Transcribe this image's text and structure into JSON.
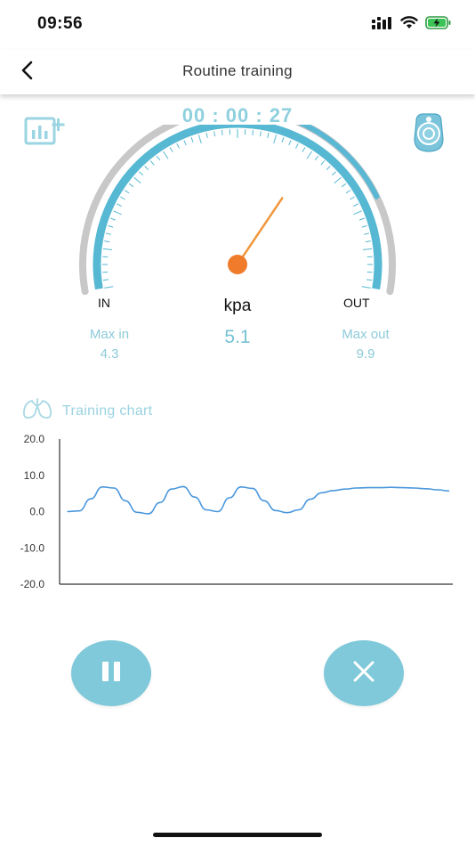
{
  "status": {
    "time": "09:56",
    "icons": [
      "signal-icon",
      "wifi-icon",
      "battery-charging-icon"
    ]
  },
  "header": {
    "title": "Routine training",
    "back_icon": "chevron-left-icon"
  },
  "session": {
    "timer": "00 : 00 : 27",
    "left_icon": "chart-add-icon",
    "right_icon": "device-icon"
  },
  "gauge": {
    "in_label": "IN",
    "out_label": "OUT",
    "unit": "kpa",
    "needle_fraction": 0.67,
    "progress_fraction_start": 0.54,
    "progress_fraction_end": 0.82,
    "colors": {
      "track": "#c8c8c8",
      "scale": "#56b8d2",
      "progress": "#5ab8d4",
      "needle": "#f0973c",
      "pivot": "#ef7b2b"
    }
  },
  "stats": {
    "max_in_label": "Max in",
    "max_in_value": "4.3",
    "current_value": "5.1",
    "max_out_label": "Max out",
    "max_out_value": "9.9"
  },
  "training": {
    "title": "Training chart",
    "icon": "lungs-icon"
  },
  "chart_data": {
    "type": "line",
    "ylim": [
      -20,
      20
    ],
    "yticks": [
      "20.0",
      "10.0",
      "0.0",
      "-10.0",
      "-20.0"
    ],
    "ytick_values": [
      20,
      10,
      0,
      -10,
      -20
    ],
    "x": [
      0,
      3,
      6,
      9,
      12,
      15,
      18,
      21,
      24,
      27,
      30,
      33,
      36,
      39,
      42,
      45,
      48,
      51,
      54,
      57,
      60,
      63,
      66,
      69,
      72,
      75,
      78,
      81,
      84,
      87,
      90,
      93,
      96,
      99
    ],
    "series": [
      {
        "values": [
          0,
          0.2,
          3.5,
          6.8,
          6.5,
          3.0,
          -0.2,
          -0.6,
          2.5,
          6.2,
          6.9,
          4.0,
          0.5,
          0,
          3.8,
          6.8,
          6.4,
          3.0,
          0.3,
          -0.3,
          0.5,
          3.4,
          5.2,
          5.8,
          6.2,
          6.5,
          6.6,
          6.6,
          6.7,
          6.6,
          6.5,
          6.3,
          6.0,
          5.7
        ],
        "color": "#4a97dc"
      }
    ],
    "xlim": [
      0,
      100
    ],
    "grid": false
  },
  "controls": {
    "pause_icon": "pause-icon",
    "stop_icon": "close-icon"
  }
}
